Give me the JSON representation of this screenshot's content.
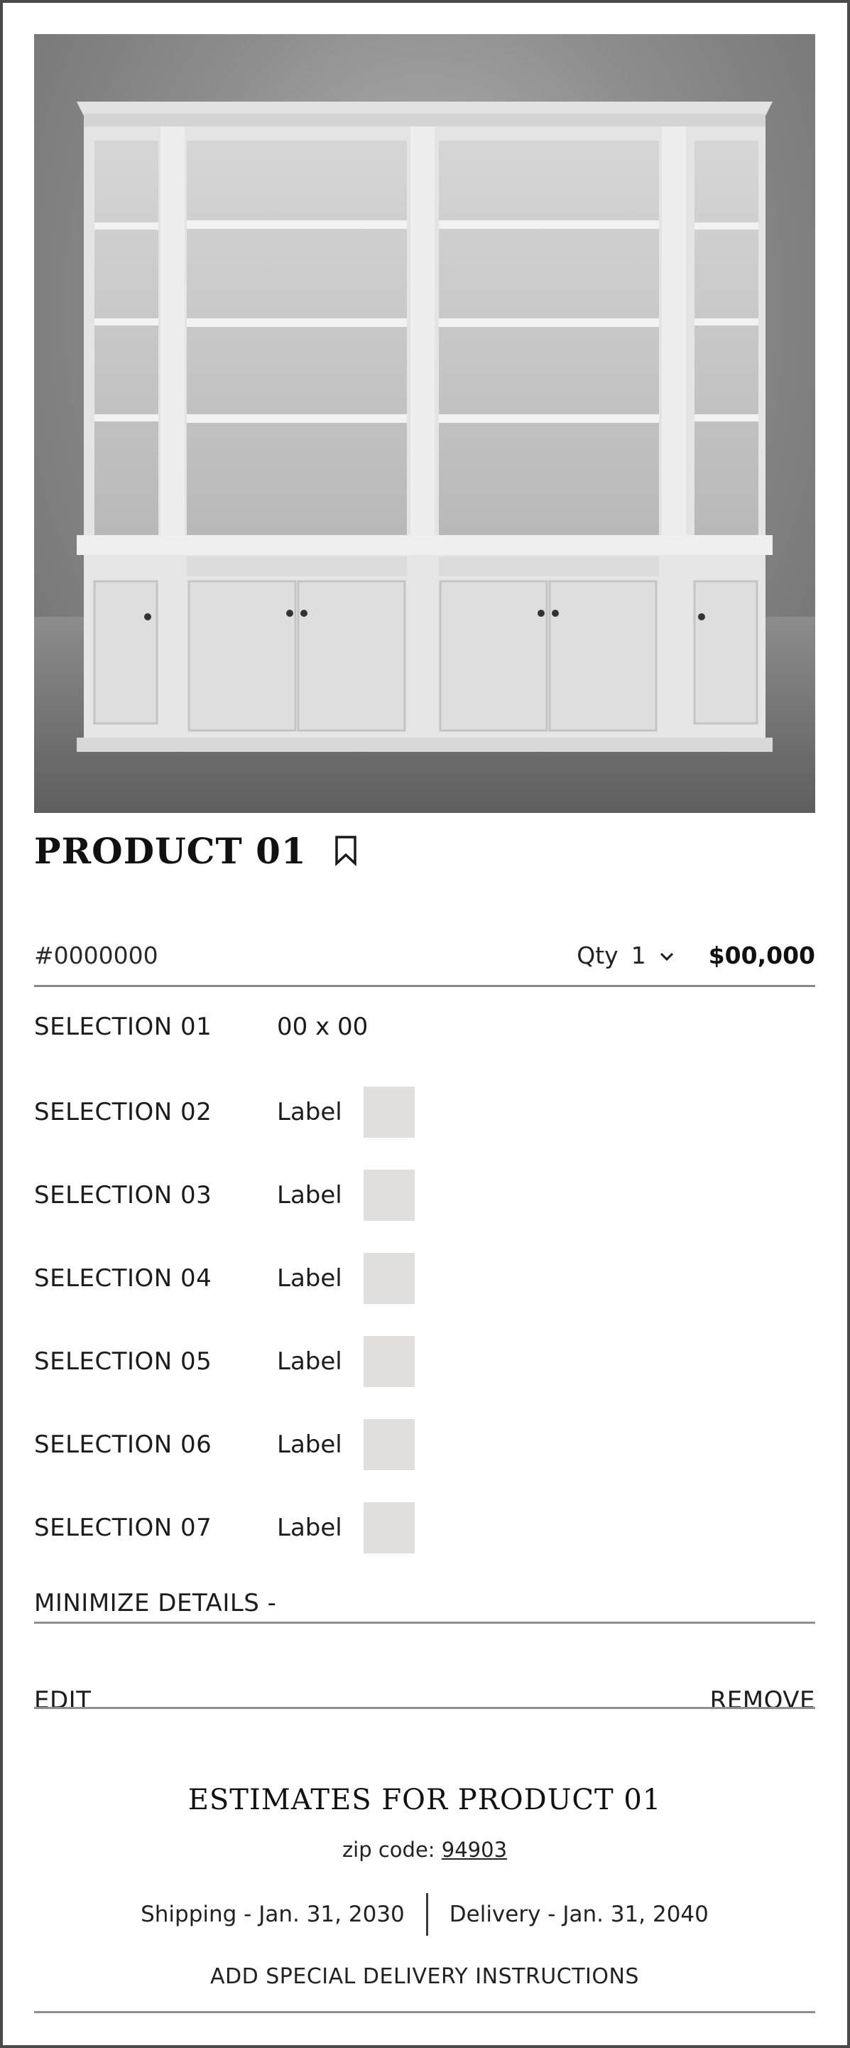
{
  "product": {
    "title": "PRODUCT 01",
    "image_alt": "bookcase-cabinet-photo",
    "sku": "#0000000",
    "qty_label": "Qty",
    "qty_value": "1",
    "price": "$00,000"
  },
  "selections": [
    {
      "label": "SELECTION 01",
      "value": "00 x 00",
      "has_swatch": false
    },
    {
      "label": "SELECTION 02",
      "value": "Label",
      "has_swatch": true
    },
    {
      "label": "SELECTION 03",
      "value": "Label",
      "has_swatch": true
    },
    {
      "label": "SELECTION 04",
      "value": "Label",
      "has_swatch": true
    },
    {
      "label": "SELECTION 05",
      "value": "Label",
      "has_swatch": true
    },
    {
      "label": "SELECTION 06",
      "value": "Label",
      "has_swatch": true
    },
    {
      "label": "SELECTION 07",
      "value": "Label",
      "has_swatch": true
    }
  ],
  "details": {
    "minimize_label": "MINIMIZE DETAILS -"
  },
  "actions": {
    "edit_label": "EDIT",
    "remove_label": "REMOVE"
  },
  "estimates": {
    "title": "ESTIMATES FOR PRODUCT 01",
    "zip_prefix": "zip code:",
    "zip_value": "94903",
    "shipping": "Shipping - Jan. 31, 2030",
    "delivery": "Delivery - Jan. 31, 2040",
    "special_instructions": "ADD SPECIAL DELIVERY INSTRUCTIONS"
  },
  "icons": {
    "bookmark": "bookmark-icon",
    "qty_dropdown": "chevron-down-icon"
  },
  "colors": {
    "swatch": "#e0dfdc",
    "rule": "#8f8f8f",
    "frame": "#4a4a4a"
  }
}
